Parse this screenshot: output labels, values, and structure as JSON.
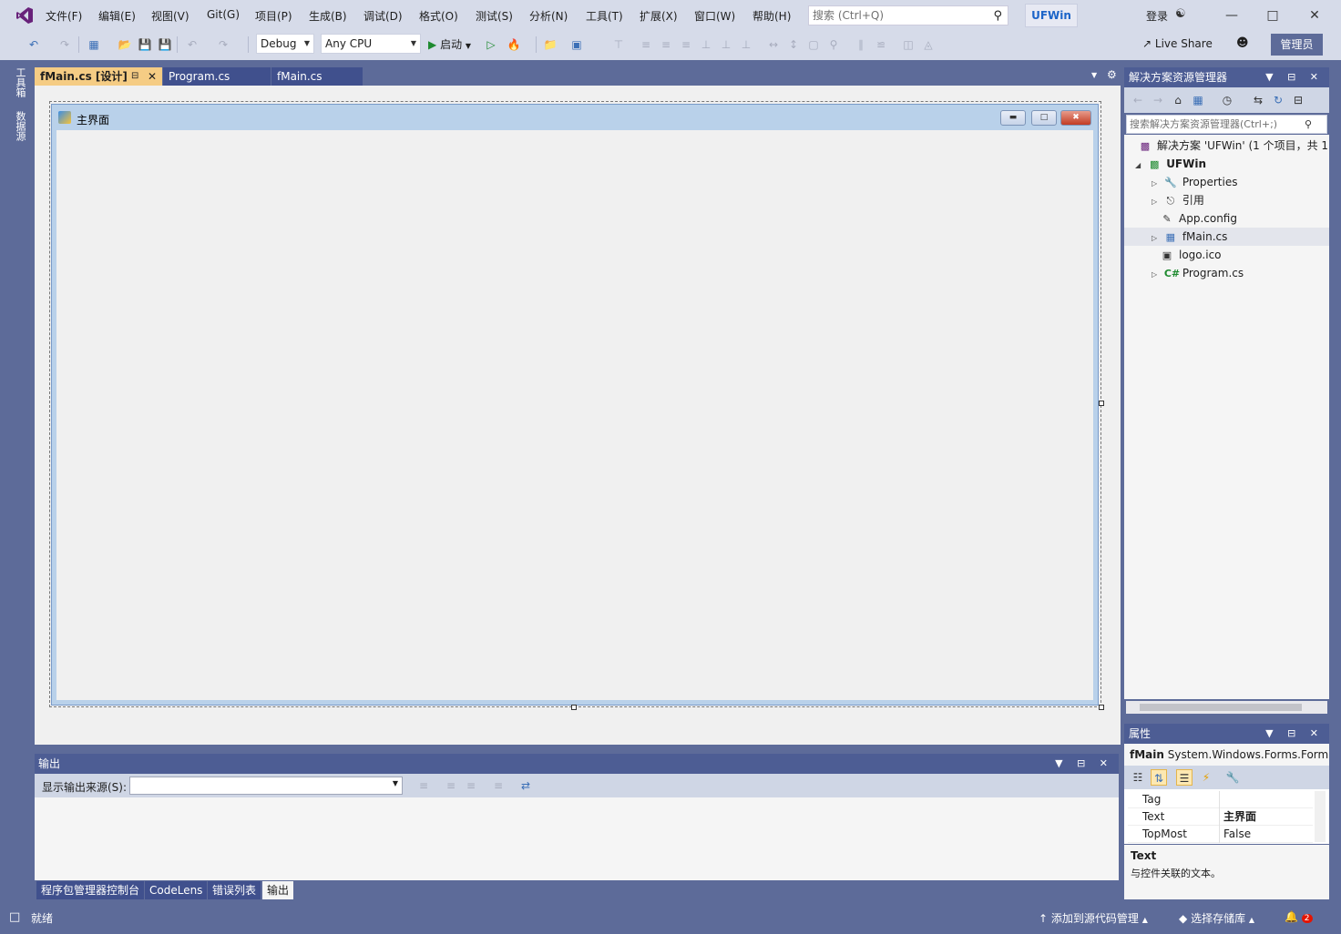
{
  "titlebar": {
    "menus": [
      "文件(F)",
      "编辑(E)",
      "视图(V)",
      "Git(G)",
      "项目(P)",
      "生成(B)",
      "调试(D)",
      "格式(O)",
      "测试(S)",
      "分析(N)",
      "工具(T)",
      "扩展(X)",
      "窗口(W)",
      "帮助(H)"
    ],
    "search_placeholder": "搜索 (Ctrl+Q)",
    "project_name": "UFWin",
    "login": "登录"
  },
  "toolbar": {
    "config": "Debug",
    "platform": "Any CPU",
    "start_label": "启动",
    "live_share": "Live Share",
    "admin": "管理员"
  },
  "left_strip": {
    "toolbox": "工具箱",
    "datasource": "数据源"
  },
  "doc_tabs": [
    {
      "label": "fMain.cs [设计]",
      "active": true
    },
    {
      "label": "Program.cs",
      "active": false
    },
    {
      "label": "fMain.cs",
      "active": false
    }
  ],
  "designer": {
    "form_caption": "主界面"
  },
  "output": {
    "title": "输出",
    "source_label": "显示输出来源(S):",
    "tabs": [
      "程序包管理器控制台",
      "CodeLens",
      "错误列表",
      "输出"
    ]
  },
  "solution_explorer": {
    "title": "解决方案资源管理器",
    "search_placeholder": "搜索解决方案资源管理器(Ctrl+;)",
    "solution": "解决方案 'UFWin' (1 个项目，共 1",
    "project": "UFWin",
    "items": [
      "Properties",
      "引用",
      "App.config",
      "fMain.cs",
      "logo.ico",
      "Program.cs"
    ]
  },
  "properties": {
    "title": "属性",
    "object_name": "fMain",
    "object_type": "System.Windows.Forms.Form",
    "rows": [
      {
        "name": "Tag",
        "value": ""
      },
      {
        "name": "Text",
        "value": "主界面"
      },
      {
        "name": "TopMost",
        "value": "False"
      }
    ],
    "desc_title": "Text",
    "desc_text": "与控件关联的文本。"
  },
  "status": {
    "ready": "就绪",
    "add_source": "添加到源代码管理",
    "select_repo": "选择存储库",
    "notifications": "2"
  },
  "colors": {
    "accent": "#5d6b99",
    "active_tab": "#f5cc84",
    "vs_purple": "#68217a"
  }
}
